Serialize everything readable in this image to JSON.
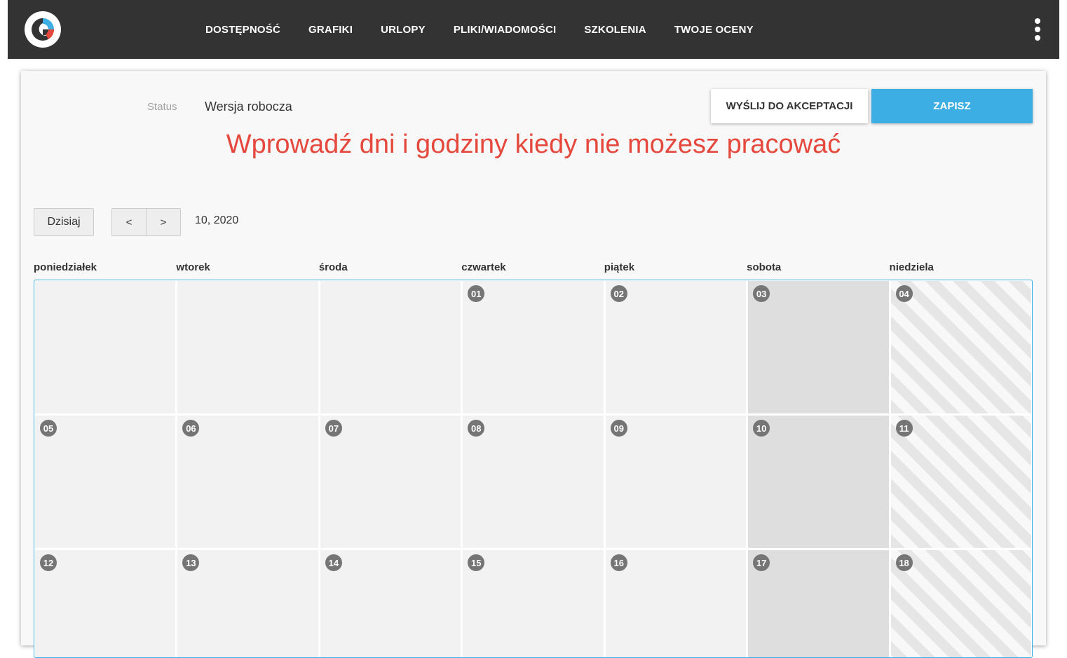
{
  "nav": {
    "items": [
      {
        "label": "DOSTĘPNOŚĆ"
      },
      {
        "label": "GRAFIKI"
      },
      {
        "label": "URLOPY"
      },
      {
        "label": "PLIKI/WIADOMOŚCI"
      },
      {
        "label": "SZKOLENIA"
      },
      {
        "label": "TWOJE OCENY"
      }
    ],
    "menu_icon": "kebab-menu-icon"
  },
  "status": {
    "label": "Status",
    "value": "Wersja robocza"
  },
  "actions": {
    "send_label": "WYŚLIJ DO AKCEPTACJI",
    "save_label": "ZAPISZ"
  },
  "headline": "Wprowadź dni i godziny kiedy nie możesz pracować",
  "calendar_nav": {
    "today_label": "Dzisiaj",
    "prev_label": "<",
    "next_label": ">",
    "month_label": "10, 2020"
  },
  "weekdays": [
    "poniedziałek",
    "wtorek",
    "środa",
    "czwartek",
    "piątek",
    "sobota",
    "niedziela"
  ],
  "days": [
    {
      "num": "",
      "type": "empty"
    },
    {
      "num": "",
      "type": "empty"
    },
    {
      "num": "",
      "type": "empty"
    },
    {
      "num": "01",
      "type": "weekday"
    },
    {
      "num": "02",
      "type": "weekday"
    },
    {
      "num": "03",
      "type": "sat"
    },
    {
      "num": "04",
      "type": "sun"
    },
    {
      "num": "05",
      "type": "weekday"
    },
    {
      "num": "06",
      "type": "weekday"
    },
    {
      "num": "07",
      "type": "weekday"
    },
    {
      "num": "08",
      "type": "weekday"
    },
    {
      "num": "09",
      "type": "weekday"
    },
    {
      "num": "10",
      "type": "sat"
    },
    {
      "num": "11",
      "type": "sun"
    },
    {
      "num": "12",
      "type": "weekday"
    },
    {
      "num": "13",
      "type": "weekday"
    },
    {
      "num": "14",
      "type": "weekday"
    },
    {
      "num": "15",
      "type": "weekday"
    },
    {
      "num": "16",
      "type": "weekday"
    },
    {
      "num": "17",
      "type": "sat"
    },
    {
      "num": "18",
      "type": "sun"
    }
  ],
  "colors": {
    "topbar": "#333333",
    "accent": "#3daee3",
    "headline": "#e5483c",
    "day_badge": "#757575"
  }
}
